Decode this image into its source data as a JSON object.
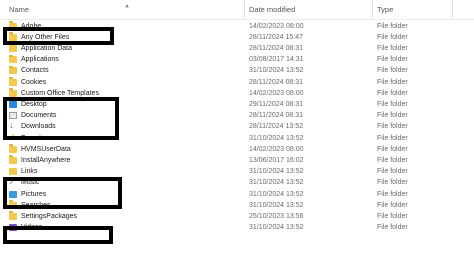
{
  "columns": {
    "name": "Name",
    "date": "Date modified",
    "type": "Type"
  },
  "rows": [
    {
      "name": "Adobe",
      "date": "14/02/2023 08:00",
      "type": "File folder",
      "icon": "folder-icon"
    },
    {
      "name": "Any Other Files",
      "date": "28/11/2024 15:47",
      "type": "File folder",
      "icon": "folder-icon"
    },
    {
      "name": "Application Data",
      "date": "28/11/2024 08:31",
      "type": "File folder",
      "icon": "folder-icon"
    },
    {
      "name": "Applications",
      "date": "03/08/2017 14:31",
      "type": "File folder",
      "icon": "folder-icon"
    },
    {
      "name": "Contacts",
      "date": "31/10/2024 13:52",
      "type": "File folder",
      "icon": "folder-icon"
    },
    {
      "name": "Cookies",
      "date": "28/11/2024 08:31",
      "type": "File folder",
      "icon": "folder-icon"
    },
    {
      "name": "Custom Office Templates",
      "date": "14/02/2023 08:00",
      "type": "File folder",
      "icon": "folder-icon"
    },
    {
      "name": "Desktop",
      "date": "29/11/2024 08:31",
      "type": "File folder",
      "icon": "desktop-icon"
    },
    {
      "name": "Documents",
      "date": "28/11/2024 08:31",
      "type": "File folder",
      "icon": "documents-icon"
    },
    {
      "name": "Downloads",
      "date": "28/11/2024 13:52",
      "type": "File folder",
      "icon": "downloads-icon"
    },
    {
      "name": "Favorites",
      "date": "31/10/2024 13:52",
      "type": "File folder",
      "icon": "favorites-icon"
    },
    {
      "name": "HVMSUserData",
      "date": "14/02/2023 08:00",
      "type": "File folder",
      "icon": "folder-icon"
    },
    {
      "name": "InstallAnywhere",
      "date": "13/06/2017 16:02",
      "type": "File folder",
      "icon": "folder-icon"
    },
    {
      "name": "Links",
      "date": "31/10/2024 13:52",
      "type": "File folder",
      "icon": "links-icon"
    },
    {
      "name": "Music",
      "date": "31/10/2024 13:52",
      "type": "File folder",
      "icon": "music-icon"
    },
    {
      "name": "Pictures",
      "date": "31/10/2024 13:52",
      "type": "File folder",
      "icon": "pictures-icon"
    },
    {
      "name": "Searches",
      "date": "31/10/2024 13:52",
      "type": "File folder",
      "icon": "folder-icon"
    },
    {
      "name": "SettingsPackages",
      "date": "25/10/2023 13:56",
      "type": "File folder",
      "icon": "folder-icon"
    },
    {
      "name": "Videos",
      "date": "31/10/2024 13:52",
      "type": "File folder",
      "icon": "videos-icon"
    }
  ]
}
